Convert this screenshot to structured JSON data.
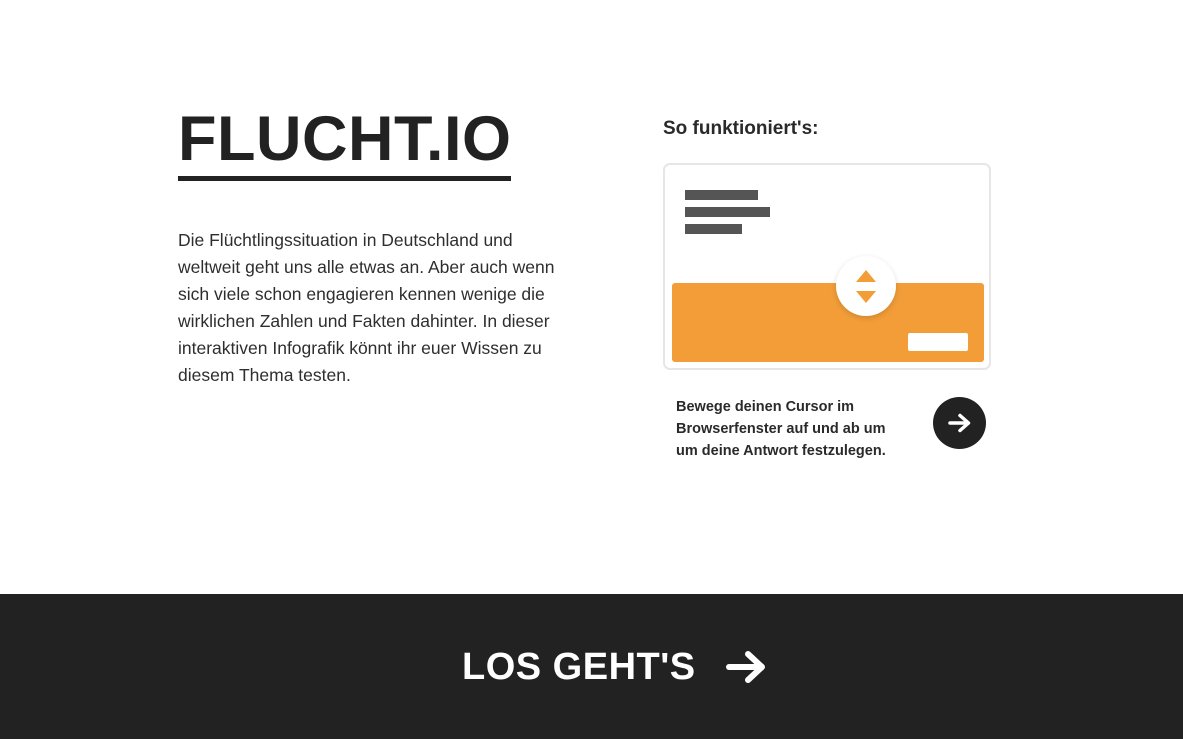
{
  "brand": {
    "title": "FLUCHT.IO"
  },
  "intro": {
    "text": "Die Flüchtlingssituation in Deutschland und weltweit geht uns alle etwas an. Aber auch wenn sich viele schon engagieren kennen wenige die wirklichen Zahlen und Fakten dahinter. In dieser interaktiven Infografik könnt ihr euer Wissen zu diesem Thema testen."
  },
  "howto": {
    "title": "So funktioniert's:",
    "description": "Bewege deinen Cursor im Browserfenster auf und ab um um deine Antwort festzulegen.",
    "next_icon": "arrow-right-icon",
    "slider_icon": "up-down-arrows-icon"
  },
  "footer": {
    "start_label": "LOS GEHT'S",
    "start_icon": "arrow-right-icon"
  },
  "colors": {
    "accent": "#f29d38",
    "dark": "#222222",
    "text": "#2e2e2e",
    "placeholder_lines": "#555555"
  }
}
